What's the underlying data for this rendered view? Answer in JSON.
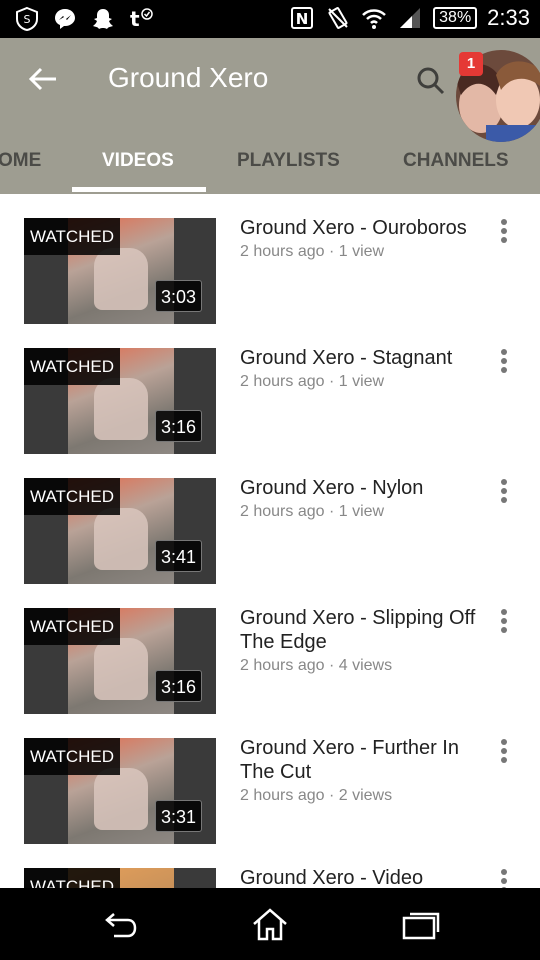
{
  "status_bar": {
    "battery": "38%",
    "time": "2:33",
    "left_icons": [
      "shield-icon",
      "messenger-icon",
      "snapchat-icon",
      "tumblr-icon"
    ],
    "right_icons": [
      "nfc-icon",
      "vibrate-icon",
      "wifi-icon",
      "signal-icon"
    ]
  },
  "header": {
    "title": "Ground Xero",
    "notification_count": "1",
    "background": "#9e9d91"
  },
  "tabs": [
    {
      "label": "OME",
      "active": false
    },
    {
      "label": "VIDEOS",
      "active": true
    },
    {
      "label": "PLAYLISTS",
      "active": false
    },
    {
      "label": "CHANNELS",
      "active": false
    }
  ],
  "videos": [
    {
      "title": "Ground Xero - Ouroboros",
      "meta": "2 hours ago · 1 view",
      "duration": "3:03",
      "watched": "WATCHED"
    },
    {
      "title": "Ground Xero - Stagnant",
      "meta": "2 hours ago · 1 view",
      "duration": "3:16",
      "watched": "WATCHED"
    },
    {
      "title": "Ground Xero - Nylon",
      "meta": "2 hours ago · 1 view",
      "duration": "3:41",
      "watched": "WATCHED"
    },
    {
      "title": "Ground Xero - Slipping Off The Edge",
      "meta": "2 hours ago · 4 views",
      "duration": "3:16",
      "watched": "WATCHED"
    },
    {
      "title": "Ground Xero - Further In The Cut",
      "meta": "2 hours ago · 2 views",
      "duration": "3:31",
      "watched": "WATCHED"
    },
    {
      "title": "Ground Xero - Video",
      "meta": "",
      "duration": "",
      "watched": "WATCHED"
    }
  ]
}
